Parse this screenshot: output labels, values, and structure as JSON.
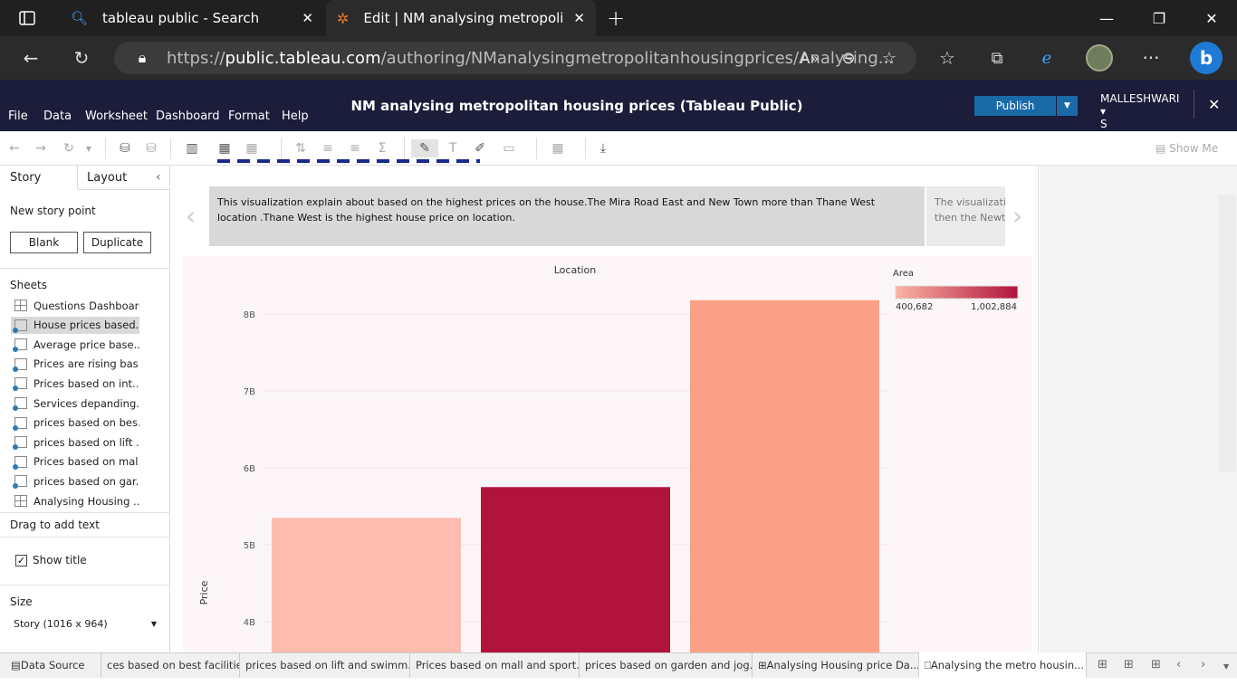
{
  "browser": {
    "tabs": [
      {
        "label": "tableau public - Search",
        "icon": "search-icon"
      },
      {
        "label": "Edit | NM analysing metropolitan",
        "icon": "tableau-icon"
      }
    ],
    "url_prefix": "https://",
    "url_host": "public.tableau.com",
    "url_rest": "/authoring/NManalysingmetropolitanhousingprices/Analysing..."
  },
  "app": {
    "menu": [
      "File",
      "Data",
      "Worksheet",
      "Dashboard",
      "Format",
      "Help"
    ],
    "title": "NM analysing metropolitan housing prices (Tableau Public)",
    "publish_label": "Publish",
    "user_line1": "MALLESHWARI ▾",
    "user_line2": "S",
    "show_me": "Show Me"
  },
  "left_pane": {
    "tab_story": "Story",
    "tab_layout": "Layout",
    "new_story_point": "New story point",
    "blank_label": "Blank",
    "duplicate_label": "Duplicate",
    "sheets_heading": "Sheets",
    "sheets": [
      {
        "label": "Questions Dashboard",
        "type": "dashboard"
      },
      {
        "label": "House prices based...",
        "type": "worksheet",
        "selected": true
      },
      {
        "label": "Average price base...",
        "type": "worksheet"
      },
      {
        "label": "Prices are rising bas...",
        "type": "worksheet"
      },
      {
        "label": "Prices based on int...",
        "type": "worksheet"
      },
      {
        "label": "Services depanding...",
        "type": "worksheet"
      },
      {
        "label": "prices based on bes...",
        "type": "worksheet"
      },
      {
        "label": "prices based on lift ...",
        "type": "worksheet"
      },
      {
        "label": "Prices based on mal...",
        "type": "worksheet"
      },
      {
        "label": "prices based on gar...",
        "type": "worksheet"
      },
      {
        "label": "Analysing Housing ...",
        "type": "dashboard"
      }
    ],
    "drag_text": "Drag to add text",
    "show_title": "Show title",
    "size_heading": "Size",
    "size_value": "Story (1016 x 964)"
  },
  "story": {
    "caption_active": "This visualization explain about based on the highest prices on the house.The Mira Road East and New Town more than Thane West location .Thane West is the highest house price on location.",
    "caption_next_line1": "The visualizati",
    "caption_next_line2": "then the Newto"
  },
  "chart_data": {
    "type": "bar",
    "title": "Location",
    "ylabel": "Price",
    "categories": [
      "",
      "",
      ""
    ],
    "values": [
      5.35,
      5.75,
      8.18
    ],
    "value_unit": "B",
    "ylim": [
      3.6,
      8.4
    ],
    "yticks": [
      4,
      5,
      6,
      7,
      8
    ],
    "ytick_labels": [
      "4B",
      "5B",
      "6B",
      "7B",
      "8B"
    ],
    "color_values": [
      400682,
      1002884,
      520000
    ],
    "colors": [
      "#fdbcaf",
      "#b0143c",
      "#fc9f89"
    ],
    "legend": {
      "title": "Area",
      "min_label": "400,682",
      "max_label": "1,002,884",
      "min_color": "#fbb4a4",
      "max_color": "#b0143c",
      "position": "top-right"
    },
    "grid": true
  },
  "bottom_tabs": [
    {
      "label": "Data Source",
      "icon": "database-icon"
    },
    {
      "label": "ces based on best facilities",
      "icon": ""
    },
    {
      "label": "prices based on lift and swimm...",
      "icon": ""
    },
    {
      "label": "Prices based on mall and sport...",
      "icon": ""
    },
    {
      "label": "prices based on garden and jog...",
      "icon": ""
    },
    {
      "label": "Analysing Housing price Da...",
      "icon": "dashboard-icon"
    },
    {
      "label": "Analysing the metro housin...",
      "icon": "story-icon",
      "selected": true
    }
  ]
}
